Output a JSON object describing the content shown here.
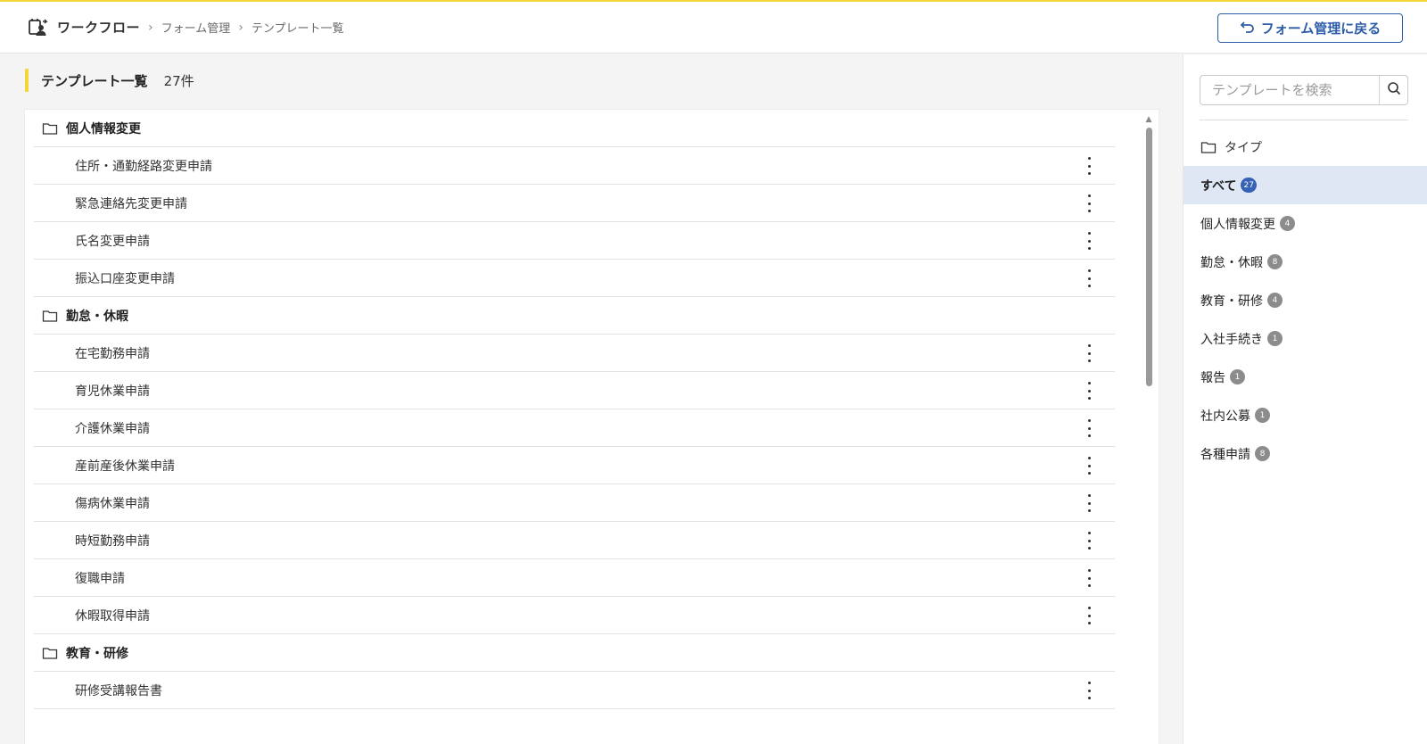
{
  "header": {
    "app_name": "ワークフロー",
    "breadcrumbs": [
      "フォーム管理",
      "テンプレート一覧"
    ],
    "back_button_label": "フォーム管理に戻る"
  },
  "main": {
    "title": "テンプレート一覧",
    "count": "27件",
    "groups": [
      {
        "title": "個人情報変更",
        "items": [
          "住所・通勤経路変更申請",
          "緊急連絡先変更申請",
          "氏名変更申請",
          "振込口座変更申請"
        ]
      },
      {
        "title": "勤怠・休暇",
        "items": [
          "在宅勤務申請",
          "育児休業申請",
          "介護休業申請",
          "産前産後休業申請",
          "傷病休業申請",
          "時短勤務申請",
          "復職申請",
          "休暇取得申請"
        ]
      },
      {
        "title": "教育・研修",
        "items": [
          "研修受講報告書"
        ]
      }
    ]
  },
  "sidebar": {
    "search_placeholder": "テンプレートを検索",
    "type_label": "タイプ",
    "filters": [
      {
        "label": "すべて",
        "count": "27",
        "active": true
      },
      {
        "label": "個人情報変更",
        "count": "4"
      },
      {
        "label": "勤怠・休暇",
        "count": "8"
      },
      {
        "label": "教育・研修",
        "count": "4"
      },
      {
        "label": "入社手続き",
        "count": "1"
      },
      {
        "label": "報告",
        "count": "1"
      },
      {
        "label": "社内公募",
        "count": "1"
      },
      {
        "label": "各種申請",
        "count": "8"
      }
    ]
  },
  "colors": {
    "accent_yellow": "#f5d63a",
    "primary_blue": "#2e5da8",
    "active_filter_bg": "#dfe7f5"
  }
}
